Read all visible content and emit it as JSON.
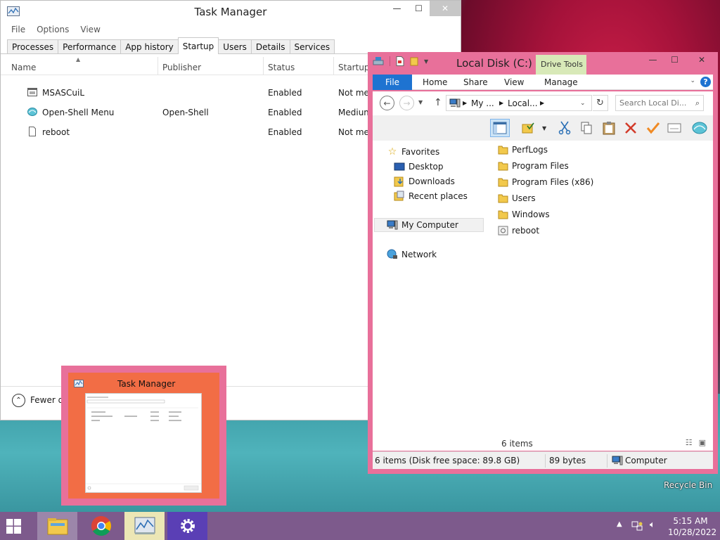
{
  "task_manager": {
    "title": "Task Manager",
    "menu": [
      "File",
      "Options",
      "View"
    ],
    "tabs": [
      "Processes",
      "Performance",
      "App history",
      "Startup",
      "Users",
      "Details",
      "Services"
    ],
    "active_tab": "Startup",
    "columns": [
      "Name",
      "Publisher",
      "Status",
      "Startup i"
    ],
    "rows": [
      {
        "icon": "app-window-icon",
        "name": "MSASCuiL",
        "publisher": "",
        "status": "Enabled",
        "impact": "Not mea"
      },
      {
        "icon": "open-shell-icon",
        "name": "Open-Shell Menu",
        "publisher": "Open-Shell",
        "status": "Enabled",
        "impact": "Medium"
      },
      {
        "icon": "document-icon",
        "name": "reboot",
        "publisher": "",
        "status": "Enabled",
        "impact": "Not mea"
      }
    ],
    "footer_label": "Fewer de"
  },
  "explorer": {
    "title": "Local Disk (C:)",
    "context_tab": "Drive Tools",
    "ribbon_tabs": [
      "File",
      "Home",
      "Share",
      "View",
      "Manage"
    ],
    "breadcrumb": [
      "My ...",
      "Local..."
    ],
    "search_placeholder": "Search Local Di...",
    "nav": {
      "favorites": "Favorites",
      "favorite_items": [
        "Desktop",
        "Downloads",
        "Recent places"
      ],
      "computer": "My Computer",
      "network": "Network"
    },
    "files": [
      {
        "name": "PerfLogs",
        "type": "folder"
      },
      {
        "name": "Program Files",
        "type": "folder"
      },
      {
        "name": "Program Files (x86)",
        "type": "folder"
      },
      {
        "name": "Users",
        "type": "folder"
      },
      {
        "name": "Windows",
        "type": "folder"
      },
      {
        "name": "reboot",
        "type": "file"
      }
    ],
    "items_count": "6 items",
    "status": {
      "left": "6 items (Disk free space: 89.8 GB)",
      "size": "89 bytes",
      "location": "Computer"
    }
  },
  "thumbnail": {
    "title": "Task Manager"
  },
  "desktop": {
    "recycle_bin": "Recycle Bin"
  },
  "taskbar": {
    "time": "5:15 AM",
    "date": "10/28/2022",
    "items": [
      "file-explorer-icon",
      "chrome-icon",
      "task-manager-icon",
      "settings-gear-icon"
    ]
  },
  "colors": {
    "accent_blue": "#1e73d1",
    "window_border_pink": "#e8709a",
    "taskbar": "#7d5a8c",
    "drive_tools": "#d8e9b8"
  }
}
